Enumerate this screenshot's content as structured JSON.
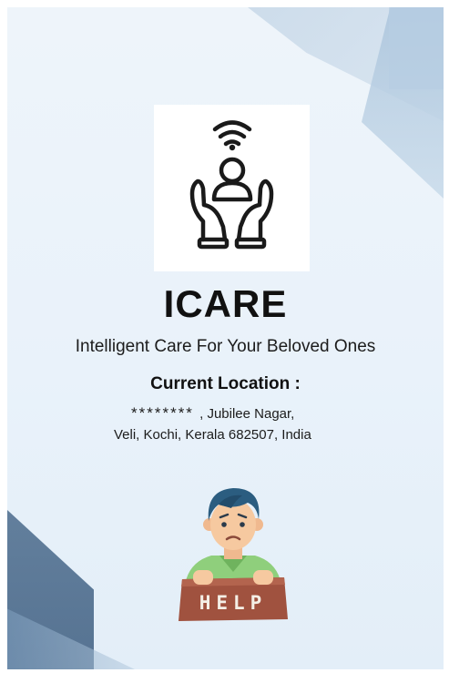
{
  "app": {
    "name": "ICARE",
    "tagline": "Intelligent Care For Your Beloved Ones"
  },
  "logo": {
    "icon": "wifi-person-hands-care-icon"
  },
  "location": {
    "heading": "Current Location :",
    "masked_part": "********",
    "line1_rest": " , Jubilee Nagar,",
    "line2": "Veli, Kochi, Kerala 682507, India"
  },
  "help_button": {
    "label": "HELP",
    "icon": "person-holding-help-sign-icon"
  },
  "colors": {
    "background": "#eaf2fa",
    "title": "#111111",
    "help_sign": "#a0523f",
    "accent_dark": "#3d5d80"
  }
}
